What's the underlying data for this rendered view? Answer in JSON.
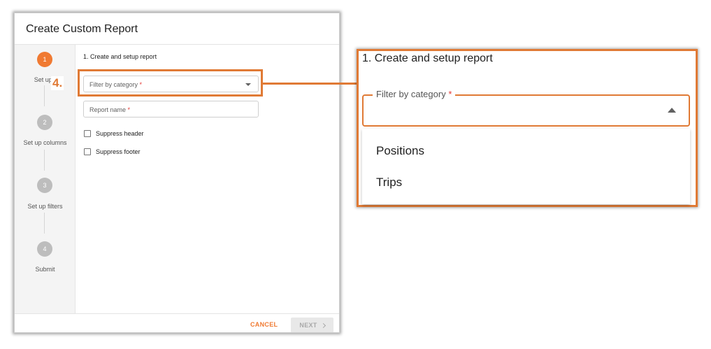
{
  "dialog": {
    "title": "Create Custom Report",
    "steps": [
      {
        "number": "1",
        "label": "Set up r",
        "active": true
      },
      {
        "number": "2",
        "label": "Set up columns",
        "active": false
      },
      {
        "number": "3",
        "label": "Set up filters",
        "active": false
      },
      {
        "number": "4",
        "label": "Submit",
        "active": false
      }
    ],
    "section_title": "1. Create and setup report",
    "fields": {
      "filter_by_category": {
        "label": "Filter by category",
        "required_mark": "*"
      },
      "report_name": {
        "label": "Report name",
        "required_mark": "*"
      }
    },
    "checkboxes": [
      {
        "label": "Suppress header",
        "checked": false
      },
      {
        "label": "Suppress footer",
        "checked": false
      }
    ],
    "footer": {
      "cancel_label": "CANCEL",
      "next_label": "NEXT"
    }
  },
  "callout": {
    "step_number": "4.",
    "color": "#e07a35"
  },
  "zoom": {
    "title": "1. Create and setup report",
    "field_label": "Filter by category",
    "required_mark": "*",
    "options": [
      "Positions",
      "Trips"
    ]
  },
  "colors": {
    "accent": "#f07a32",
    "callout": "#e07a35",
    "required": "#e53935",
    "inactive_step": "#bdbdbd"
  }
}
